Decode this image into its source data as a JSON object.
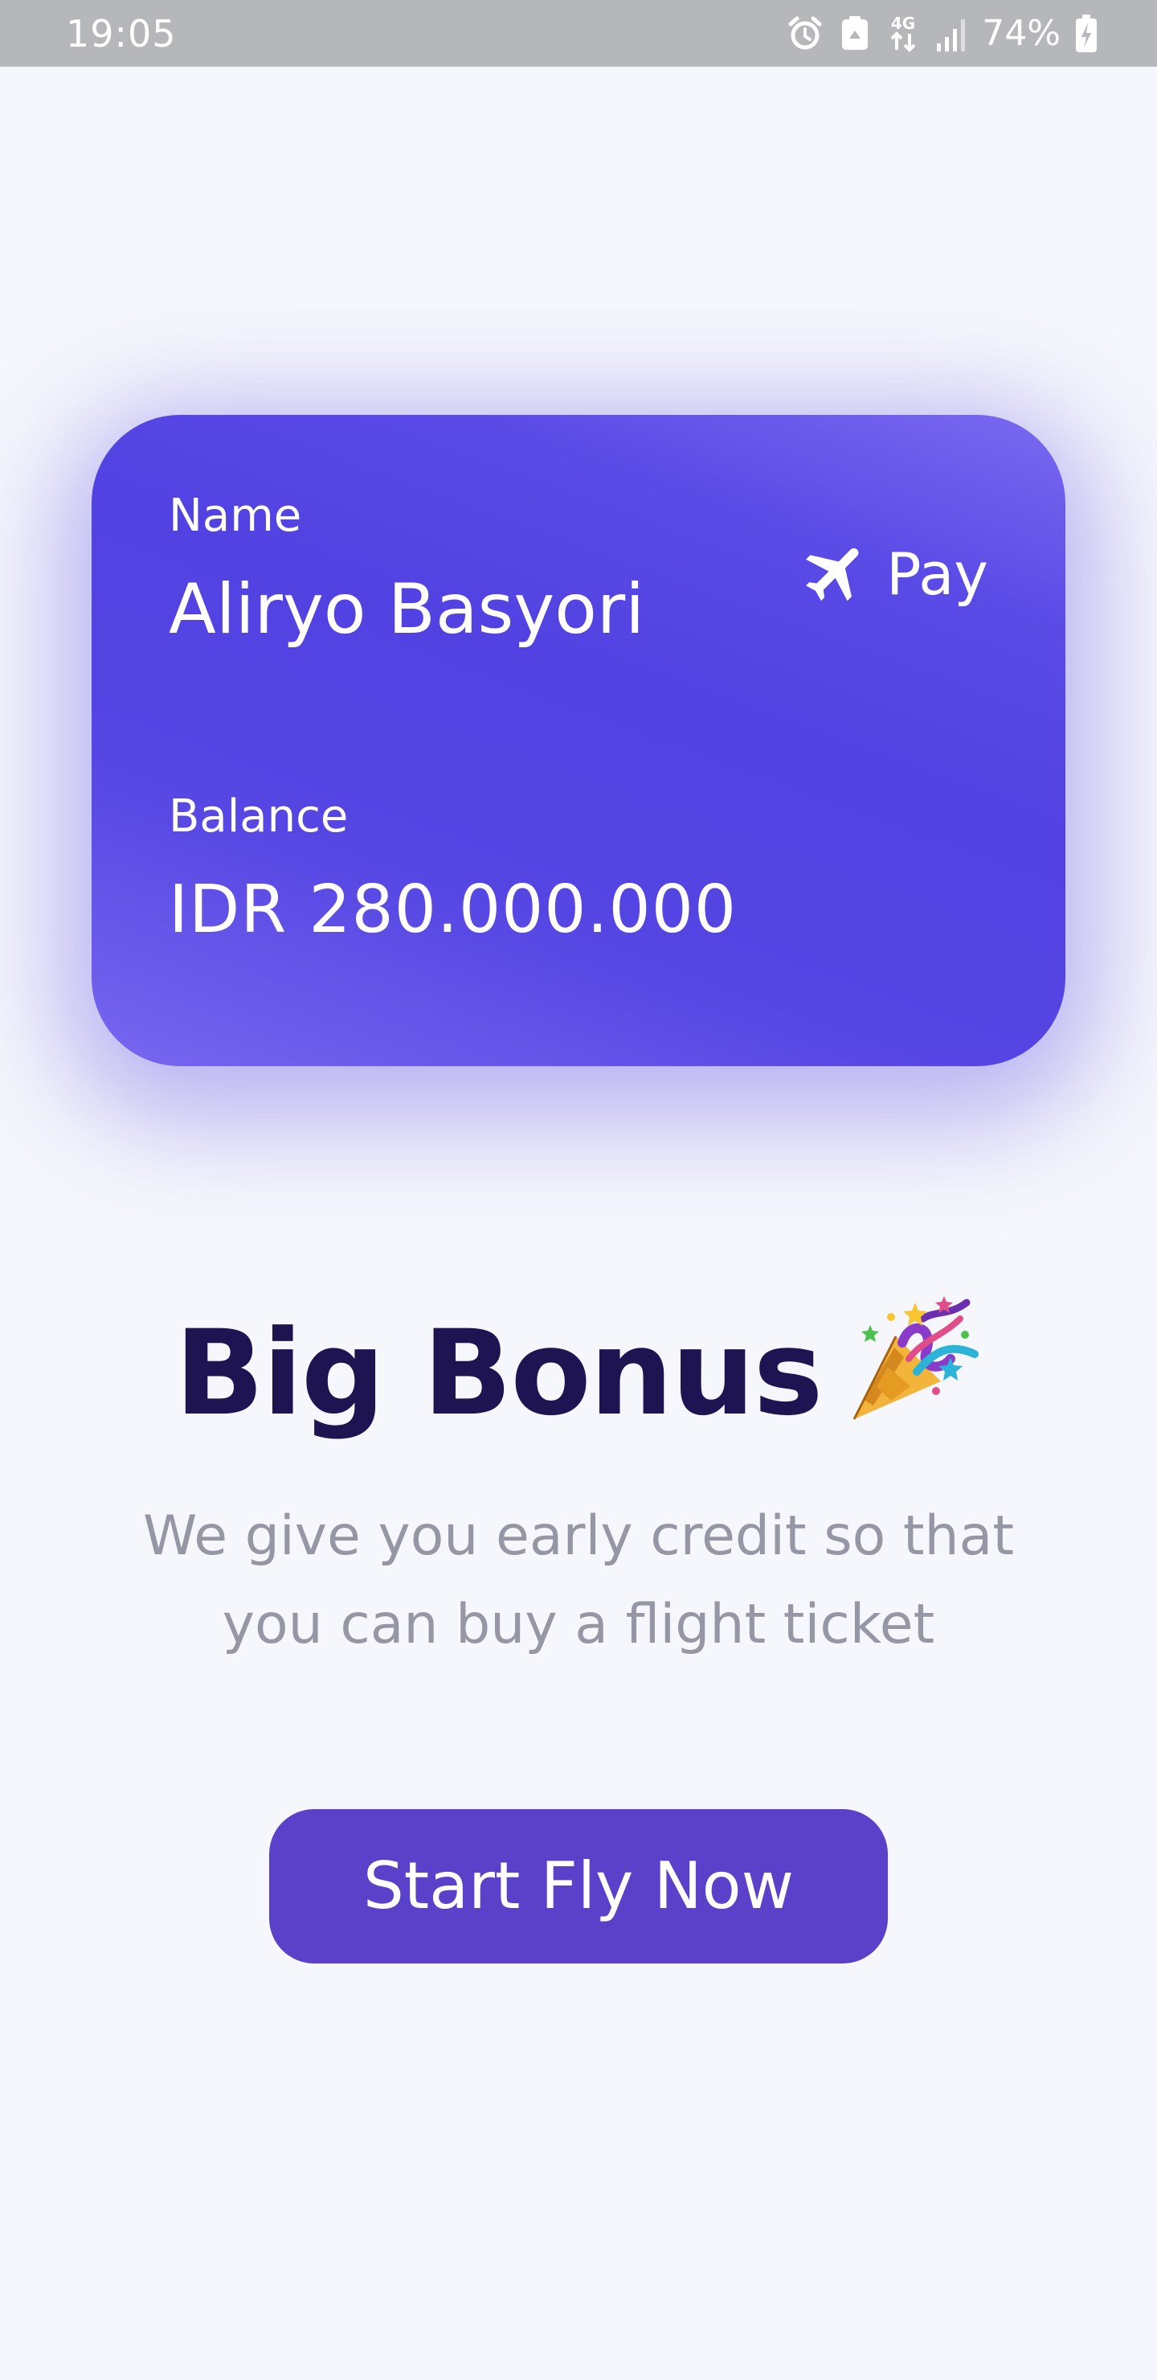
{
  "status_bar": {
    "time": "19:05",
    "network": "4G",
    "battery": "74%",
    "icons": [
      "alarm-icon",
      "recycle-icon",
      "network-4g-icon",
      "signal-icon",
      "battery-charging-icon"
    ]
  },
  "card": {
    "name_label": "Name",
    "name_value": "Aliryo Basyori",
    "brand_icon": "airplane-icon",
    "brand_label": "Pay",
    "balance_label": "Balance",
    "balance_value": "IDR 280.000.000"
  },
  "hero": {
    "title": "Big Bonus",
    "title_icon": "party-popper-icon",
    "subtitle": "We give you early credit so that you can buy a flight ticket"
  },
  "cta": {
    "label": "Start Fly Now"
  },
  "colors": {
    "background": "#f6f7fc",
    "card_primary": "#5242e1",
    "title": "#1f1452",
    "subtitle": "#9597a4",
    "button": "#5b40c9",
    "status_bar": "#b6b7ba"
  }
}
